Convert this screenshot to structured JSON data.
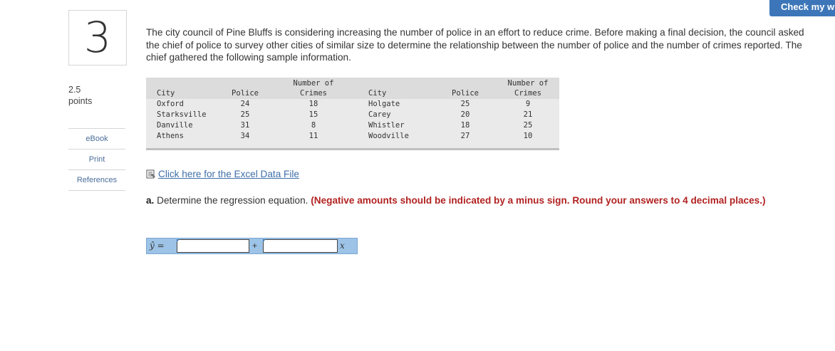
{
  "question": {
    "number": "3",
    "points_value": "2.5",
    "points_label": "points"
  },
  "side_links": [
    "eBook",
    "Print",
    "References"
  ],
  "check_button_label": "Check my w",
  "prompt": "The city council of Pine Bluffs is considering increasing the number of police in an effort to reduce crime. Before making a final decision, the council asked the chief of police to survey other cities of similar size to determine the relationship between the number of police and the number of crimes reported. The chief gathered the following sample information.",
  "table": {
    "header_top": {
      "crimes1": "Number of",
      "crimes2": "Number of"
    },
    "header": {
      "city1": "City",
      "police1": "Police",
      "crimes1": "Crimes",
      "city2": "City",
      "police2": "Police",
      "crimes2": "Crimes"
    },
    "rows": [
      {
        "city1": "Oxford",
        "police1": "24",
        "crimes1": "18",
        "city2": "Holgate",
        "police2": "25",
        "crimes2": "9"
      },
      {
        "city1": "Starksville",
        "police1": "25",
        "crimes1": "15",
        "city2": "Carey",
        "police2": "20",
        "crimes2": "21"
      },
      {
        "city1": "Danville",
        "police1": "31",
        "crimes1": "8",
        "city2": "Whistler",
        "police2": "18",
        "crimes2": "25"
      },
      {
        "city1": "Athens",
        "police1": "34",
        "crimes1": "11",
        "city2": "Woodville",
        "police2": "27",
        "crimes2": "10"
      }
    ]
  },
  "excel_link": {
    "icon": "excel-file-icon",
    "label": " Click here for the Excel Data File"
  },
  "part_a": {
    "label": "a.",
    "text": " Determine the regression equation. ",
    "instruction": "(Negative amounts should be indicated by a minus sign. Round your answers to 4 decimal places.)"
  },
  "equation": {
    "lhs": "ŷ =",
    "plus": "+",
    "x": "x",
    "intercept_value": "",
    "slope_value": ""
  },
  "colors": {
    "accent": "#3d76b8",
    "instruction_red": "#b22222",
    "equation_bg": "#9dc3e6",
    "link": "#3f6fa8"
  }
}
